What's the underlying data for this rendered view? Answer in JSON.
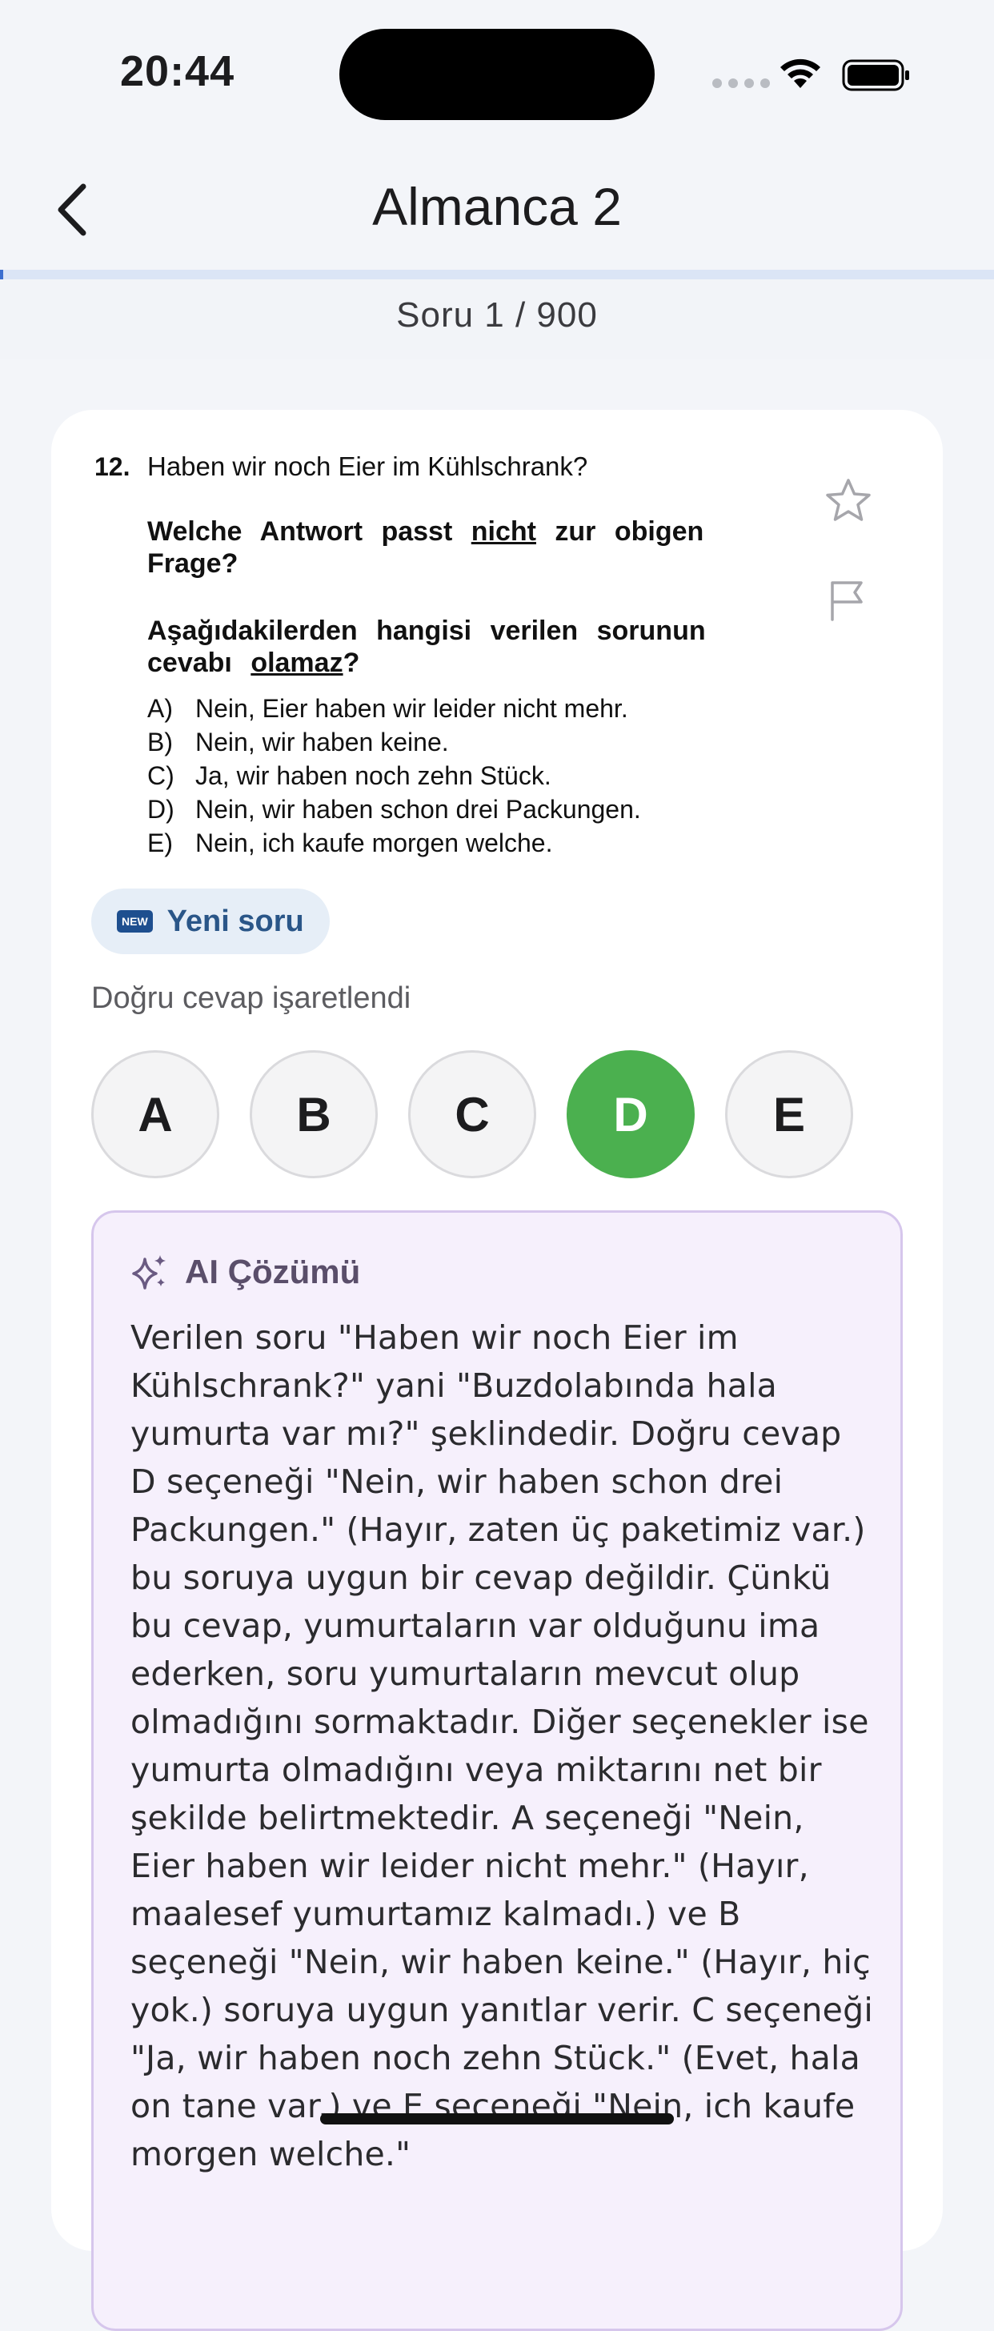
{
  "status_bar": {
    "time": "20:44"
  },
  "header": {
    "title": "Almanca 2",
    "back_icon": "chevron-left-icon"
  },
  "progress": {
    "current": 1,
    "total": 900,
    "fraction": 0.0011,
    "counter_text": "Soru 1 / 900",
    "accent": "#3b6ecf"
  },
  "question": {
    "number": "12.",
    "prompt": "Haben wir noch Eier im Kühlschrank?",
    "instruction_de_1": "Welche Antwort passt ",
    "instruction_de_nicht": "nicht",
    "instruction_de_2": " zur obigen",
    "instruction_de_3": "Frage?",
    "instruction_tr_1": "Aşağıdakilerden hangisi verilen sorunun",
    "instruction_tr_2": "cevabı ",
    "instruction_tr_olamaz": "olamaz",
    "instruction_tr_3": "?",
    "choices": [
      {
        "label": "A)",
        "text": "Nein, Eier haben wir leider nicht mehr."
      },
      {
        "label": "B)",
        "text": "Nein, wir haben keine."
      },
      {
        "label": "C)",
        "text": "Ja, wir haben noch zehn Stück."
      },
      {
        "label": "D)",
        "text": "Nein, wir haben schon drei Packungen."
      },
      {
        "label": "E)",
        "text": "Nein, ich kaufe morgen welche."
      }
    ]
  },
  "actions": {
    "star_icon": "star-icon",
    "flag_icon": "flag-icon"
  },
  "chip": {
    "badge": "NEW",
    "label": "Yeni soru"
  },
  "answer_note": "Doğru cevap işaretlendi",
  "options": [
    {
      "letter": "A",
      "state": "default"
    },
    {
      "letter": "B",
      "state": "default"
    },
    {
      "letter": "C",
      "state": "default"
    },
    {
      "letter": "D",
      "state": "correct"
    },
    {
      "letter": "E",
      "state": "default"
    }
  ],
  "colors": {
    "correct": "#4bb04f",
    "ai_bg": "#f6f0fc",
    "ai_border": "#d6c6ec"
  },
  "ai_solution": {
    "title": "AI Çözümü",
    "icon": "sparkles-icon",
    "text": "Verilen soru \"Haben wir noch Eier im Kühlschrank?\" yani \"Buzdolabında hala yumurta var mı?\" şeklindedir. Doğru cevap D seçeneği \"Nein, wir haben schon drei Packungen.\" (Hayır, zaten üç paketimiz var.) bu soruya uygun bir cevap değildir. Çünkü bu cevap, yumurtaların var olduğunu ima ederken, soru yumurtaların mevcut olup olmadığını sormaktadır. Diğer seçenekler ise yumurta olmadığını veya miktarını net bir şekilde belirtmektedir. A seçeneği \"Nein, Eier haben wir leider nicht mehr.\" (Hayır, maalesef yumurtamız kalmadı.) ve B seçeneği \"Nein, wir haben keine.\" (Hayır, hiç yok.) soruya uygun yanıtlar verir. C seçeneği \"Ja, wir haben noch zehn Stück.\" (Evet, hala on tane var.) ve E seçeneği \"Nein, ich kaufe morgen welche.\""
  }
}
